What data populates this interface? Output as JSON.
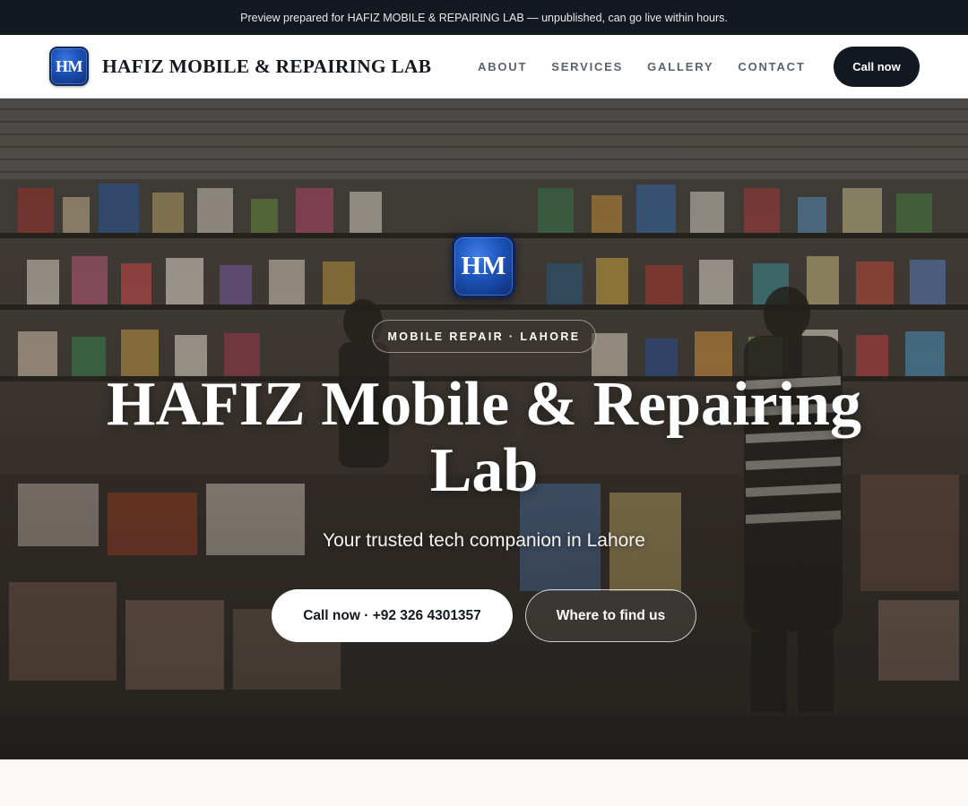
{
  "preview_banner": "Preview prepared for HAFIZ MOBILE & REPAIRING LAB — unpublished, can go live within hours.",
  "nav": {
    "logo_text": "HM",
    "brand": "HAFIZ MOBILE & REPAIRING LAB",
    "links": [
      "ABOUT",
      "SERVICES",
      "GALLERY",
      "CONTACT"
    ],
    "cta": "Call now"
  },
  "hero": {
    "logo_text": "HM",
    "tag": "MOBILE REPAIR · LAHORE",
    "title": "HAFIZ Mobile & Repairing Lab",
    "subtitle": "Your trusted tech companion in Lahore",
    "primary_button": "Call now · +92 326 4301357",
    "secondary_button": "Where to find us",
    "background_image": "shop-storefront-photo"
  },
  "colors": {
    "dark": "#141820",
    "logo_blue": "#1a4fb3",
    "nav_link": "#5a6270",
    "page_bg": "#faf8f4"
  }
}
